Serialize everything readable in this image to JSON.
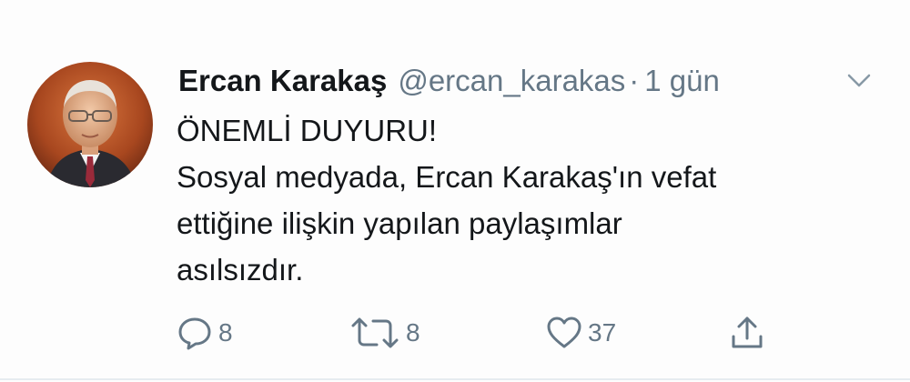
{
  "tweet": {
    "display_name": "Ercan Karakaş",
    "handle": "@ercan_karakas",
    "separator": "·",
    "time": "1 gün",
    "lines": [
      "ÖNEMLİ DUYURU!",
      "Sosyal medyada, Ercan Karakaş'ın vefat",
      "ettiğine ilişkin yapılan paylaşımlar",
      "asılsızdır."
    ]
  },
  "actions": {
    "reply_count": "8",
    "retweet_count": "8",
    "like_count": "37"
  },
  "icons": {
    "reply": "reply-icon",
    "retweet": "retweet-icon",
    "like": "heart-icon",
    "share": "share-icon",
    "menu": "chevron-down-icon"
  },
  "colors": {
    "text": "#14171a",
    "secondary": "#657786",
    "divider": "#e6ecf0"
  }
}
